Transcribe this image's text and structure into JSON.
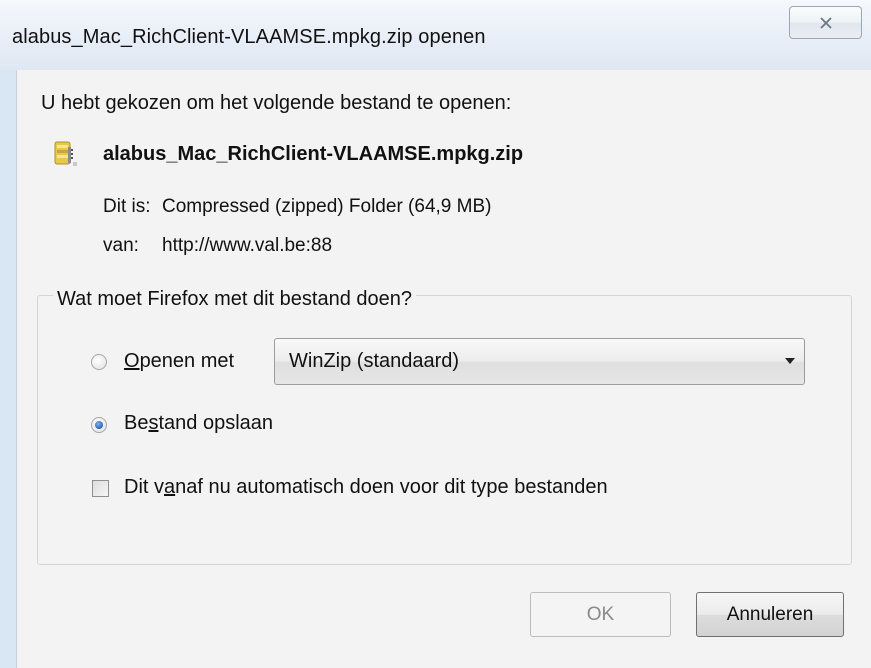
{
  "window": {
    "title": "alabus_Mac_RichClient-VLAAMSE.mpkg.zip openen",
    "close_icon": "close-x-icon"
  },
  "dialog": {
    "intro": "U hebt gekozen om het volgende bestand te openen:",
    "file_icon": "zip-archive-icon",
    "filename": "alabus_Mac_RichClient-VLAAMSE.mpkg.zip",
    "type_label": "Dit is:",
    "type_value": "Compressed (zipped) Folder (64,9 MB)",
    "source_label": "van:",
    "source_value": "http://www.val.be:88"
  },
  "action_group": {
    "legend": "Wat moet Firefox met dit bestand doen?",
    "open_with": {
      "label_pre": "",
      "label_accel": "O",
      "label_post": "penen met",
      "checked": false,
      "selected_app": "WinZip (standaard)"
    },
    "save_file": {
      "label_pre": "Be",
      "label_accel": "s",
      "label_post": "tand opslaan",
      "checked": true
    },
    "auto_checkbox": {
      "label_pre": "Dit v",
      "label_accel": "a",
      "label_post": "naf nu automatisch doen voor dit type bestanden",
      "checked": false
    }
  },
  "buttons": {
    "ok": "OK",
    "cancel": "Annuleren"
  }
}
